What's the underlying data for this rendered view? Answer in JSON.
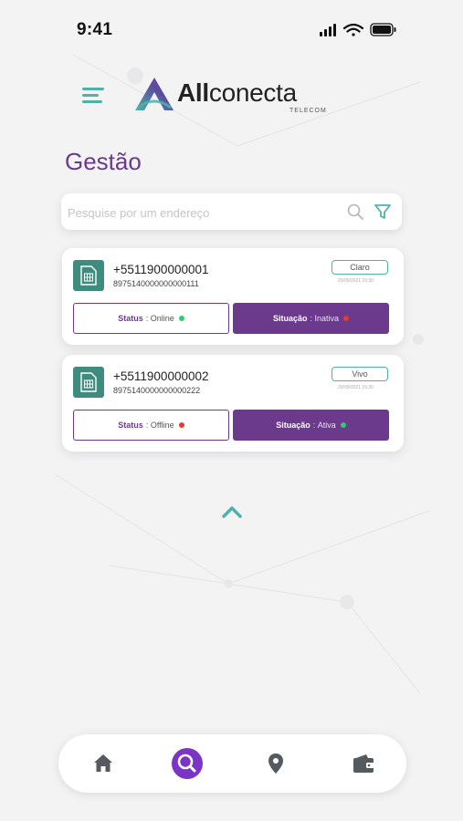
{
  "statusbar": {
    "time": "9:41"
  },
  "brand": {
    "name_bold": "All",
    "name_rest": "conecta",
    "subtitle": "TELECOM"
  },
  "page": {
    "title": "Gestão"
  },
  "search": {
    "placeholder": "Pesquise por um endereço",
    "value": ""
  },
  "lines": [
    {
      "phone": "+5511900000001",
      "iccid": "8975140000000000111",
      "carrier": "Claro",
      "date": "20/09/2021 15:30",
      "status_label": "Status",
      "status_value": "Online",
      "status_color": "#2ecc71",
      "situation_label": "Situação",
      "situation_value": "Inativa",
      "situation_color": "#e53935"
    },
    {
      "phone": "+5511900000002",
      "iccid": "8975140000000000222",
      "carrier": "Vivo",
      "date": "20/09/2021 15:30",
      "status_label": "Status",
      "status_value": "Offline",
      "status_color": "#e53935",
      "situation_label": "Situação",
      "situation_value": "Ativa",
      "situation_color": "#2ecc71"
    }
  ],
  "nav": {
    "items": [
      {
        "icon": "home-icon",
        "active": false
      },
      {
        "icon": "search-icon",
        "active": true
      },
      {
        "icon": "location-pin-icon",
        "active": false
      },
      {
        "icon": "wallet-icon",
        "active": false
      }
    ]
  },
  "colors": {
    "accent": "#6b3a8c",
    "teal": "#4db3a8",
    "nav_active": "#7b35c4",
    "sim": "#3d8c7f"
  }
}
